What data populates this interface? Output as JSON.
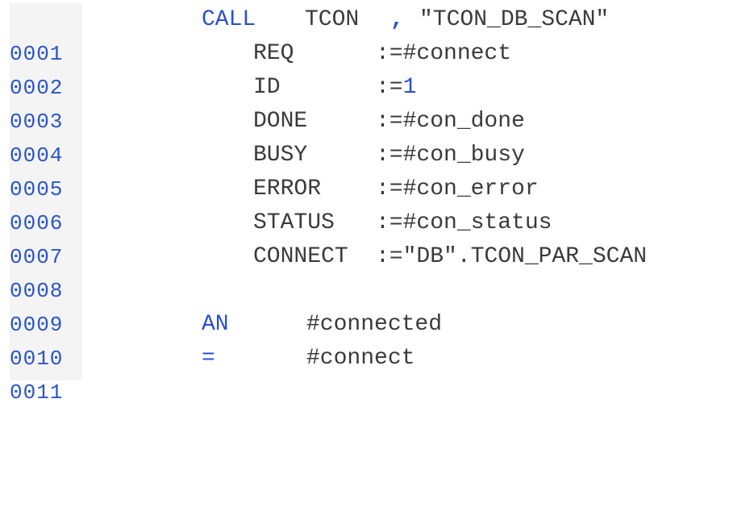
{
  "editor": {
    "lines": [
      {
        "number": "0001",
        "keyword": "CALL",
        "name": "TCON",
        "comma": ",",
        "target": "\"TCON_DB_SCAN\""
      },
      {
        "number": "0002",
        "param": "REQ",
        "assign": ":=#connect"
      },
      {
        "number": "0003",
        "param": "ID",
        "assign_prefix": ":=",
        "assign_value": "1"
      },
      {
        "number": "0004",
        "param": "DONE",
        "assign": ":=#con_done"
      },
      {
        "number": "0005",
        "param": "BUSY",
        "assign": ":=#con_busy"
      },
      {
        "number": "0006",
        "param": "ERROR",
        "assign": ":=#con_error"
      },
      {
        "number": "0007",
        "param": "STATUS",
        "assign": ":=#con_status"
      },
      {
        "number": "0008",
        "param": "CONNECT",
        "assign": ":=\"DB\".TCON_PAR_SCAN"
      },
      {
        "number": "0009"
      },
      {
        "number": "0010",
        "keyword": "AN",
        "operand": "#connected"
      },
      {
        "number": "0011",
        "keyword": "=",
        "operand": "#connect"
      }
    ],
    "colors": {
      "line_number": "#2a55c8",
      "keyword": "#2a4fd0",
      "text": "#3a3a3a",
      "gutter_bg": "#f4f4f4"
    }
  }
}
